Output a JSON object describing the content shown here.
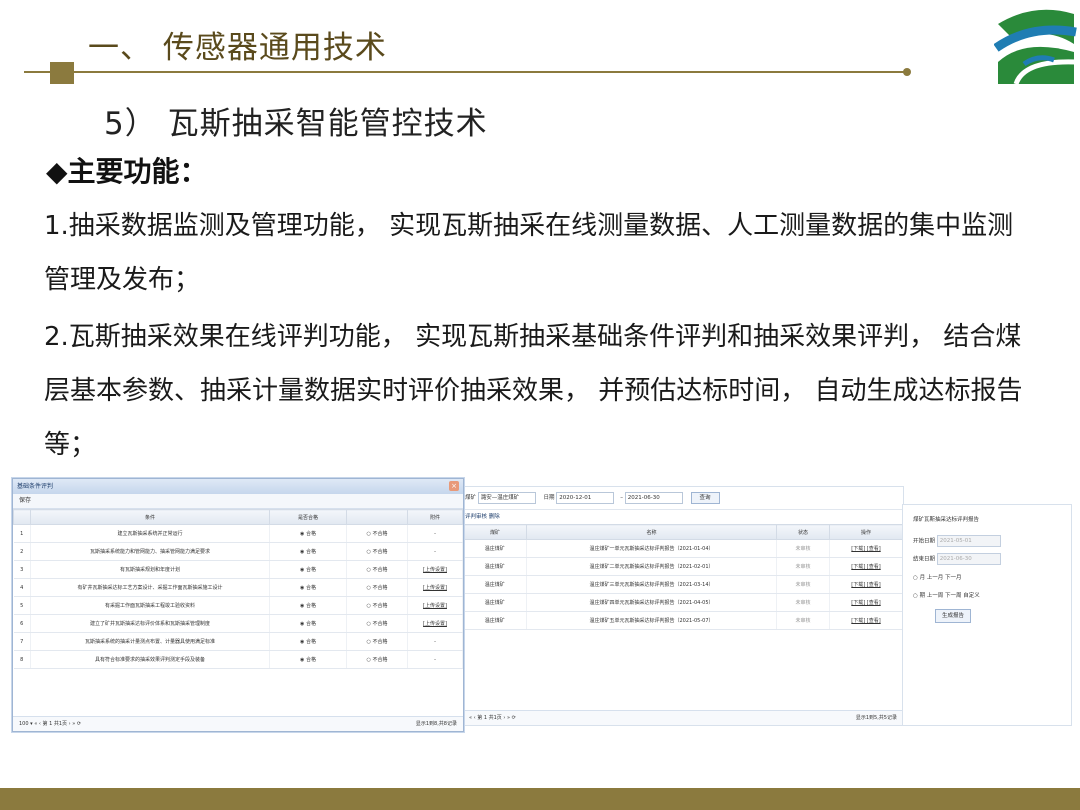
{
  "header": {
    "title": "一、  传感器通用技术",
    "subtitle": "5）  瓦斯抽采智能管控技术"
  },
  "body": {
    "heading_marker": "◆",
    "heading": "主要功能：",
    "para1": "1.抽采数据监测及管理功能， 实现瓦斯抽采在线测量数据、人工测量数据的集中监测管理及发布；",
    "para2": "2.瓦斯抽采效果在线评判功能， 实现瓦斯抽采基础条件评判和抽采效果评判， 结合煤层基本参数、抽采计量数据实时评价抽采效果， 并预估达标时间， 自动生成达标报告等；"
  },
  "screenshot_left": {
    "window_title": "基础条件评判",
    "close": "×",
    "toolbar_save": "保存",
    "columns": [
      "",
      "条件",
      "是否合格",
      "",
      "附件"
    ],
    "rows": [
      {
        "no": "1",
        "cond": "建立瓦斯抽采系统并正常运行",
        "ok": "合格",
        "ng": "不合格",
        "att": "-"
      },
      {
        "no": "2",
        "cond": "瓦斯抽采系统能力和管网能力、抽采管网能力满足要求",
        "ok": "合格",
        "ng": "不合格",
        "att": "-"
      },
      {
        "no": "3",
        "cond": "有瓦斯抽采规划和年度计划",
        "ok": "合格",
        "ng": "不合格",
        "att": "[上传设置]"
      },
      {
        "no": "4",
        "cond": "有矿井瓦斯抽采达标工艺方案设计、采掘工作面瓦斯抽采施工设计",
        "ok": "合格",
        "ng": "不合格",
        "att": "[上传设置]"
      },
      {
        "no": "5",
        "cond": "有采掘工作面瓦斯抽采工程竣工验收资料",
        "ok": "合格",
        "ng": "不合格",
        "att": "[上传设置]"
      },
      {
        "no": "6",
        "cond": "建立了矿井瓦斯抽采达标评价体系和瓦斯抽采管理制度",
        "ok": "合格",
        "ng": "不合格",
        "att": "[上传设置]"
      },
      {
        "no": "7",
        "cond": "瓦斯抽采系统的抽采计量测点布置、计量器具使用满足标准",
        "ok": "合格",
        "ng": "不合格",
        "att": "-"
      },
      {
        "no": "8",
        "cond": "具有符合标准要求的抽采效果评判测定手段及装备",
        "ok": "合格",
        "ng": "不合格",
        "att": "-"
      }
    ],
    "pager_size": "100 ▾",
    "pager_page": "1",
    "pager_of": "共1页",
    "pager_info": "显示1到8,共8记录"
  },
  "screenshot_mid": {
    "mine_label": "煤矿",
    "mine_value": "潞安—温庄煤矿",
    "date_label": "日期",
    "date_from": "2020-12-01",
    "date_to": "2021-06-30",
    "query": "查询",
    "toolbar": "评判审核   删除",
    "columns": [
      "煤矿",
      "名称",
      "状态",
      "操作"
    ],
    "rows": [
      {
        "mine": "温庄煤矿",
        "name": "温庄煤矿一单元瓦斯抽采达标评判报告（2021-01-04）",
        "status": "未审核",
        "ops": "[下载] [查看]"
      },
      {
        "mine": "温庄煤矿",
        "name": "温庄煤矿二单元瓦斯抽采达标评判报告（2021-02-01）",
        "status": "未审核",
        "ops": "[下载] [查看]"
      },
      {
        "mine": "温庄煤矿",
        "name": "温庄煤矿三单元瓦斯抽采达标评判报告（2021-03-14）",
        "status": "未审核",
        "ops": "[下载] [查看]"
      },
      {
        "mine": "温庄煤矿",
        "name": "温庄煤矿四单元瓦斯抽采达标评判报告（2021-04-05）",
        "status": "未审核",
        "ops": "[下载] [查看]"
      },
      {
        "mine": "温庄煤矿",
        "name": "温庄煤矿五单元瓦斯抽采达标评判报告（2021-05-07）",
        "status": "未审核",
        "ops": "[下载] [查看]"
      }
    ],
    "pager_page": "1",
    "pager_of": "共1页",
    "pager_info": "显示1到5,共5记录"
  },
  "screenshot_right": {
    "title": "煤矿瓦斯抽采达标评判报告",
    "start_label": "开始日期",
    "start_value": "2021-05-01",
    "end_label": "结束日期",
    "end_value": "2021-06-30",
    "month_opts": "月  上一月  下一月",
    "period_opts": "期  上一周  下一周      自定义",
    "button": "生成报告"
  }
}
